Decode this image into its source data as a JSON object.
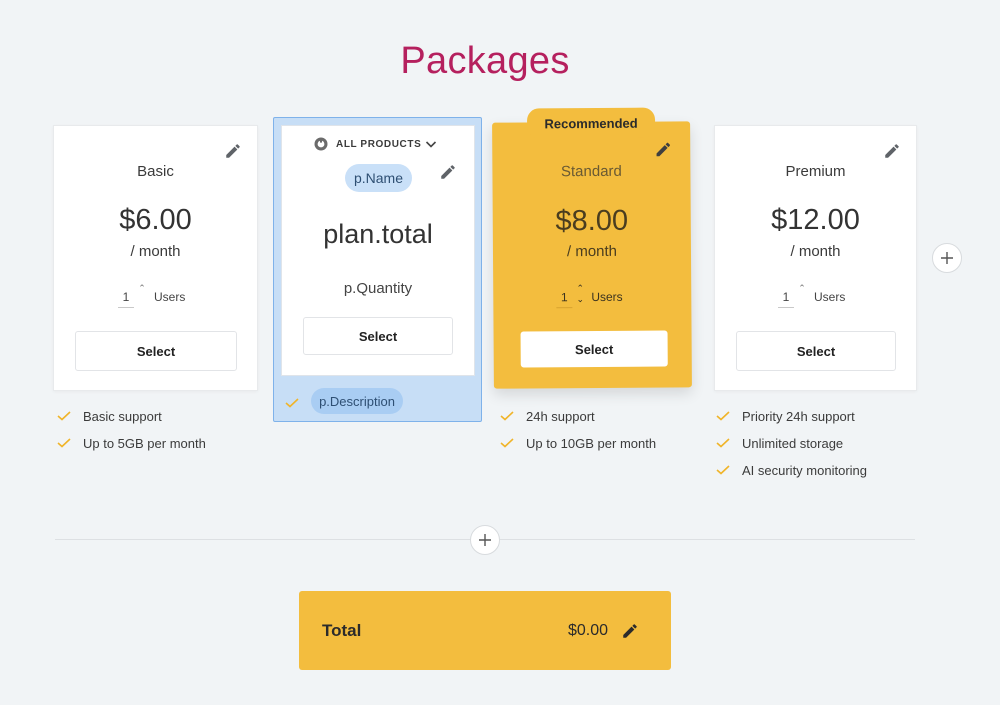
{
  "page": {
    "title": "Packages"
  },
  "plans": [
    {
      "name": "Basic",
      "price": "$6.00",
      "period": "/ month",
      "quantity": "1",
      "unit_label": "Users",
      "select_label": "Select",
      "features": [
        "Basic support",
        "Up to 5GB per month"
      ]
    },
    {
      "name": "Standard",
      "badge": "Recommended",
      "price": "$8.00",
      "period": "/ month",
      "quantity": "1",
      "unit_label": "Users",
      "select_label": "Select",
      "features": [
        "24h support",
        "Up to 10GB per month"
      ]
    },
    {
      "name": "Premium",
      "price": "$12.00",
      "period": "/ month",
      "quantity": "1",
      "unit_label": "Users",
      "select_label": "Select",
      "features": [
        "Priority 24h support",
        "Unlimited storage",
        "AI security monitoring"
      ]
    }
  ],
  "template_card": {
    "source_label": "ALL PRODUCTS",
    "name_token": "p.Name",
    "total_token": "plan.total",
    "quantity_token": "p.Quantity",
    "select_label": "Select",
    "description_token": "p.Description"
  },
  "total": {
    "label": "Total",
    "value": "$0.00"
  },
  "colors": {
    "accent": "#f3bd3e",
    "title": "#b5205e",
    "check": "#f0b429",
    "template_highlight": "#c7def6"
  }
}
